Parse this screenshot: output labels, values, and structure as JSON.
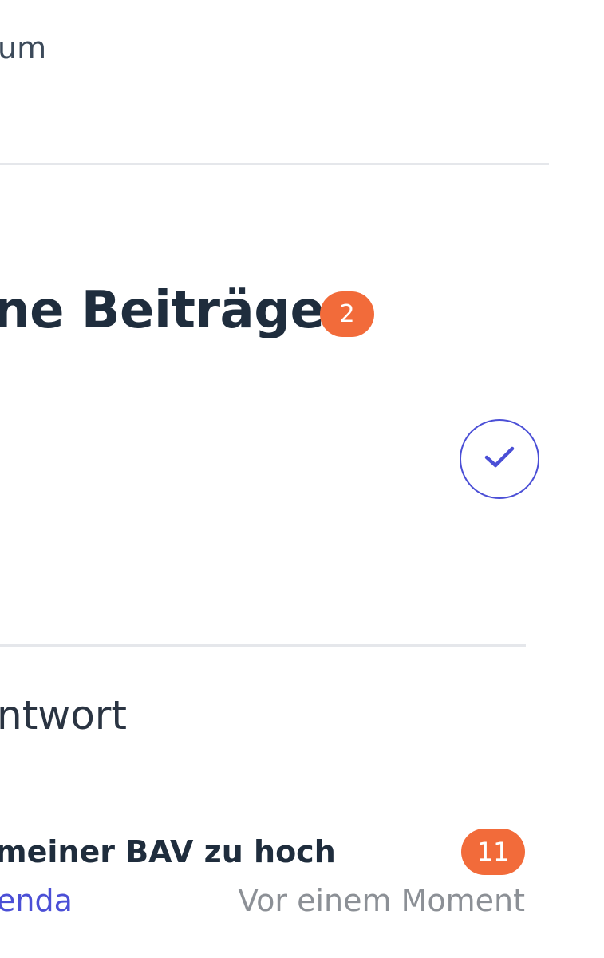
{
  "header": {
    "label": "um"
  },
  "section": {
    "title": "ne Beiträge",
    "count": "2"
  },
  "reply": {
    "label": "ntwort"
  },
  "post": {
    "title": "meiner BAV zu hoch",
    "author": "enda",
    "time": "Vor einem Moment",
    "count": "11"
  },
  "icons": {
    "confirm": "check-icon"
  },
  "colors": {
    "accent": "#4b4fd6",
    "badge": "#f26b3a",
    "text_dark": "#1f2d3d",
    "text_muted": "#8c9096",
    "divider": "#e5e7eb"
  }
}
